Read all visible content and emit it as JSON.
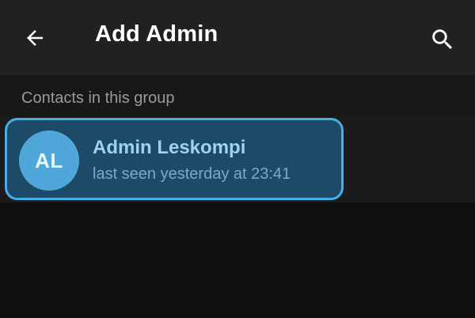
{
  "header": {
    "title": "Add Admin",
    "back_icon": "arrow-left-icon",
    "search_icon": "search-icon"
  },
  "section": {
    "label": "Contacts in this group"
  },
  "contacts": [
    {
      "initials": "AL",
      "name": "Admin Leskompi",
      "status": "last seen yesterday at 23:41"
    }
  ],
  "colors": {
    "app_bar": "#212121",
    "background": "#101010",
    "highlight_border": "#49aee6",
    "highlight_fill": "#1d4a66",
    "avatar": "#4fa6d8"
  }
}
